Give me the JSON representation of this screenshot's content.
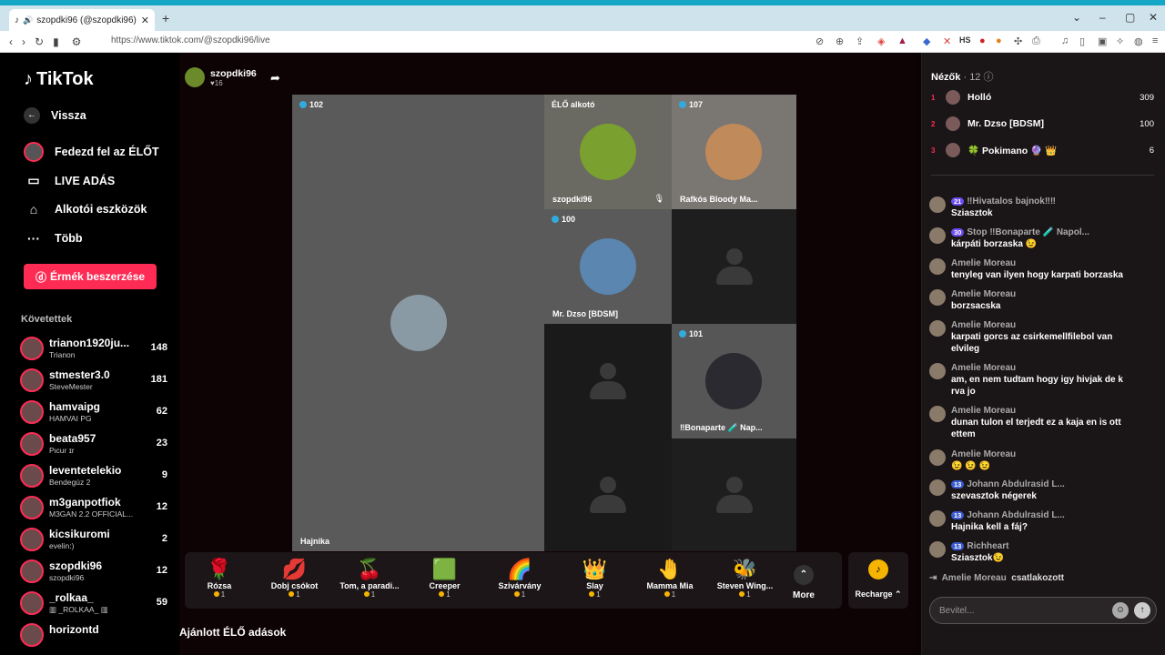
{
  "browser": {
    "tab_title": "szopdki96 (@szopdki96) ÉLŐ",
    "url": "https://www.tiktok.com/@szopdki96/live"
  },
  "sidebar": {
    "logo": "TikTok",
    "back": "Vissza",
    "nav": [
      "Fedezd fel az ÉLŐT",
      "LIVE ADÁS",
      "Alkotói eszközök",
      "Több"
    ],
    "coins_button": "Érmék beszerzése",
    "following_header": "Követettek",
    "following": [
      {
        "name": "trianon1920ju...",
        "sub": "Trianon",
        "count": "148"
      },
      {
        "name": "stmester3.0",
        "sub": "SteveMester",
        "count": "181"
      },
      {
        "name": "hamvaipg",
        "sub": "HAMVAI PG",
        "count": "62"
      },
      {
        "name": "beata957",
        "sub": "Pιcur ɪr",
        "count": "23"
      },
      {
        "name": "leventetelekio",
        "sub": "Bendegúz 2",
        "count": "9"
      },
      {
        "name": "m3ganpotfiok",
        "sub": "M3GAN 2.2 OFFICIAL...",
        "count": "12"
      },
      {
        "name": "kicsikuromi",
        "sub": "evelin:)",
        "count": "2"
      },
      {
        "name": "szopdki96",
        "sub": "szopdki96",
        "count": "12"
      },
      {
        "name": "_rolkaa_",
        "sub": "▥ _ROLKAA_ ▥",
        "count": "59"
      },
      {
        "name": "horizontd",
        "sub": "",
        "count": ""
      }
    ]
  },
  "stream": {
    "host_name": "szopdki96",
    "host_likes": "♥16",
    "tiles": {
      "main": {
        "badge": "102",
        "name": "Hajnika"
      },
      "t1": {
        "badge": "ÉLŐ alkotó",
        "name": "szopdki96"
      },
      "t2": {
        "badge": "107",
        "name": "Rafkós Bloody Ma..."
      },
      "t3": {
        "badge": "100",
        "name": "Mr. Dzso [BDSM]"
      },
      "t4": {
        "badge": "101",
        "name": "‼Bonaparte 🧪 Nap..."
      }
    },
    "gifts": [
      {
        "icon": "🌹",
        "name": "Rózsa",
        "price": "1"
      },
      {
        "icon": "💋",
        "name": "Dobj csókot",
        "price": "1"
      },
      {
        "icon": "🍒",
        "name": "Tom, a paradi...",
        "price": "1"
      },
      {
        "icon": "🟩",
        "name": "Creeper",
        "price": "1"
      },
      {
        "icon": "🌈",
        "name": "Szivárvány",
        "price": "1"
      },
      {
        "icon": "👑",
        "name": "Slay",
        "price": "1"
      },
      {
        "icon": "🤚",
        "name": "Mamma Mia",
        "price": "1"
      },
      {
        "icon": "🐝",
        "name": "Steven Wing...",
        "price": "1"
      }
    ],
    "more_label": "More",
    "recharge_label": "Recharge ⌃",
    "recommended": "Ajánlott ÉLŐ adások"
  },
  "chat": {
    "viewers_label": "Nézők",
    "viewers_count": "· 12",
    "top_viewers": [
      {
        "rank": "1",
        "name": "Holló",
        "score": "309"
      },
      {
        "rank": "2",
        "name": "Mr. Dzso [BDSM]",
        "score": "100"
      },
      {
        "rank": "3",
        "name": "🍀 Pokimano 🔮 👑",
        "score": "6"
      }
    ],
    "messages": [
      {
        "lvl": "21",
        "user": "‼Hivatalos bajnok‼‼",
        "text": "Sziasztok"
      },
      {
        "lvl": "30",
        "user": "Stop ‼Bonaparte 🧪 Napol...",
        "text": "kárpáti borzaska 😉"
      },
      {
        "lvl": "",
        "user": "Amelie Moreau",
        "text": "tenyleg van ilyen hogy karpati borzaska"
      },
      {
        "lvl": "",
        "user": "Amelie Moreau",
        "text": "borzsacska"
      },
      {
        "lvl": "",
        "user": "Amelie Moreau",
        "text": "karpati gorcs az csirkemellfilebol van elvileg"
      },
      {
        "lvl": "",
        "user": "Amelie Moreau",
        "text": "am, en nem tudtam hogy igy hivjak de k rva jo"
      },
      {
        "lvl": "",
        "user": "Amelie Moreau",
        "text": "dunan tulon el terjedt ez a kaja en is ott ettem"
      },
      {
        "lvl": "",
        "user": "Amelie Moreau",
        "text": "😉 😉 😉"
      },
      {
        "lvl": "13",
        "user": "Johann Abdulrasid L...",
        "text": "szevasztok négerek"
      },
      {
        "lvl": "13",
        "user": "Johann Abdulrasid L...",
        "text": "Hajnika kell a fáj?"
      },
      {
        "lvl": "13",
        "user": "Richheart",
        "text": "Sziasztok😉"
      }
    ],
    "joined_user": "Amelie Moreau",
    "joined_text": "csatlakozott",
    "input_placeholder": "Bevitel..."
  }
}
